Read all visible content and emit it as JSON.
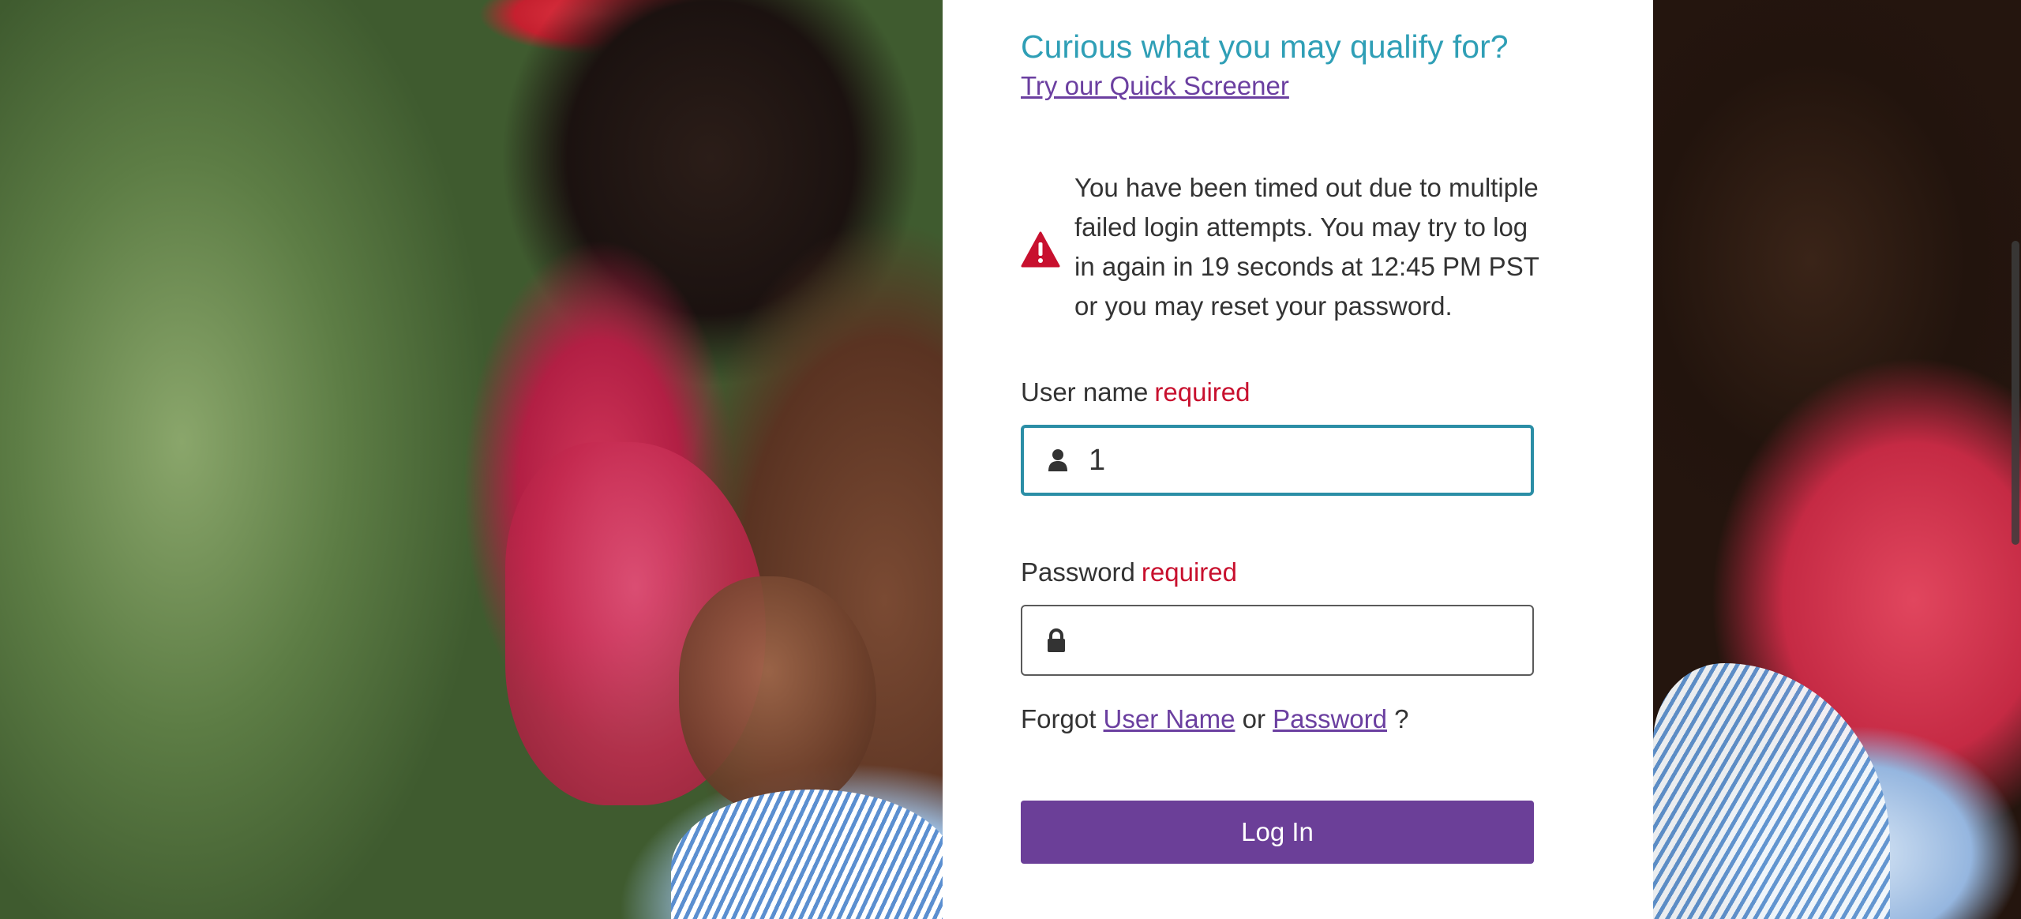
{
  "qualify": {
    "title": "Curious what you may qualify for?",
    "screener_link": "Try our Quick Screener"
  },
  "alert": {
    "icon": "warning-triangle-icon",
    "message": "You have been timed out due to multiple failed login attempts. You may try to log in again in 19 seconds at 12:45 PM PST or you may reset your password."
  },
  "username": {
    "label": "User name",
    "required": "required",
    "value": "1",
    "icon": "user-icon"
  },
  "password": {
    "label": "Password",
    "required": "required",
    "value": "",
    "icon": "lock-icon"
  },
  "forgot": {
    "prefix": "Forgot",
    "username_link": "User Name",
    "middle": "or",
    "password_link": "Password",
    "suffix": "?"
  },
  "login_button": "Log In",
  "colors": {
    "accent_teal": "#2f9fb6",
    "link_purple": "#6b3fa0",
    "button_purple": "#6b3f98",
    "required_red": "#c8102e",
    "alert_red": "#c8102e"
  }
}
